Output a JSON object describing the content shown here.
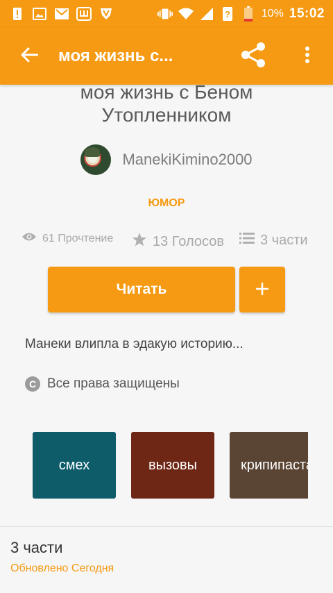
{
  "colors": {
    "accent": "#f59a12",
    "tag_1": "#0e5c6a",
    "tag_2": "#6e2615",
    "tag_3": "#5a4433"
  },
  "statusbar": {
    "battery": "10%",
    "time": "15:02",
    "icons": [
      "alert-icon",
      "image-icon",
      "gmail-icon",
      "shazam-icon",
      "vk-icon",
      "vibrate-icon",
      "wifi-icon",
      "signal-icon",
      "battery-icon"
    ]
  },
  "appbar": {
    "title": "моя жизнь с...",
    "back_icon": "arrow-left-icon",
    "share_icon": "share-icon",
    "menu_icon": "more-vert-icon"
  },
  "story": {
    "title": "моя жизнь с Беном Утопленником",
    "author": "ManekiKimino2000",
    "genre": "ЮМОР",
    "stats": {
      "reads": "61 Прочтение",
      "votes": "13 Голосов",
      "parts": "3 части"
    },
    "read_button": "Читать",
    "add_button_icon": "plus-icon",
    "description": "Манеки влипла в эдакую историю...",
    "copyright": "Все права защищены",
    "copyright_icon": "C"
  },
  "tags": [
    {
      "label": "смех"
    },
    {
      "label": "вызовы"
    },
    {
      "label": "крипипаста"
    }
  ],
  "parts_section": {
    "title": "3 части",
    "updated": "Обновлено Сегодня"
  }
}
